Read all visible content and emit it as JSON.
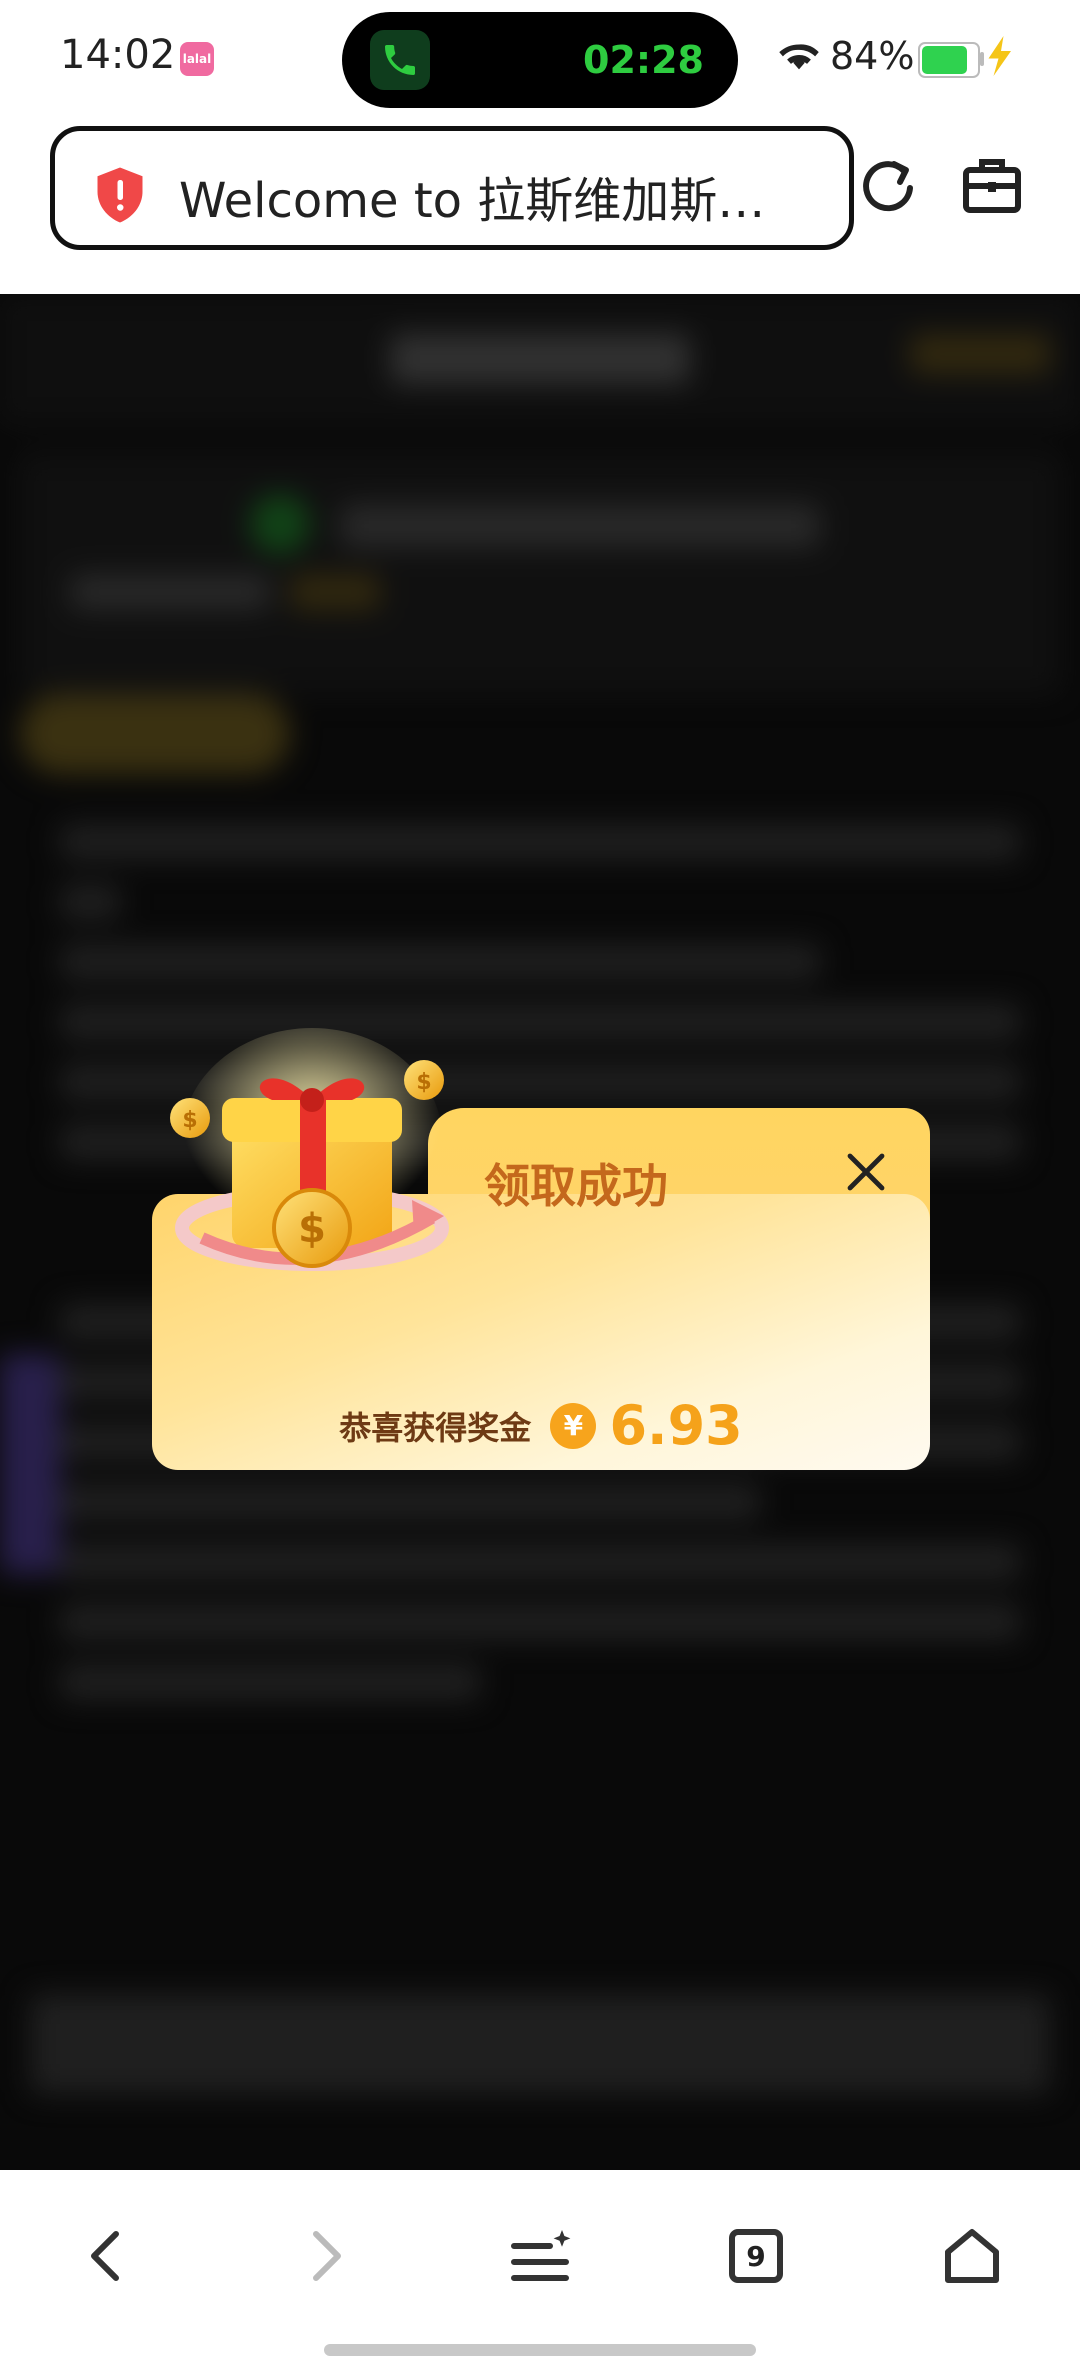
{
  "status_bar": {
    "time": "14:02",
    "app_badge": "lalal",
    "call_timer": "02:28",
    "battery_percent": "84%",
    "battery_level": 0.84
  },
  "address_bar": {
    "url_text": "Welcome to 拉斯维加斯…",
    "security_icon": "shield-alert-icon",
    "reload_icon": "reload-icon",
    "toolbox_icon": "toolbox-icon"
  },
  "popup": {
    "title": "领取成功",
    "prize_label": "恭喜获得奖金",
    "currency_symbol": "¥",
    "prize_amount": "6.93",
    "colors": {
      "title": "#c4681c",
      "amount": "#f5a21a",
      "card": "#ffd46b"
    }
  },
  "bottom_nav": {
    "tab_count": "9",
    "icons": [
      "back-icon",
      "forward-icon",
      "menu-icon",
      "tabs-icon",
      "home-icon"
    ]
  }
}
